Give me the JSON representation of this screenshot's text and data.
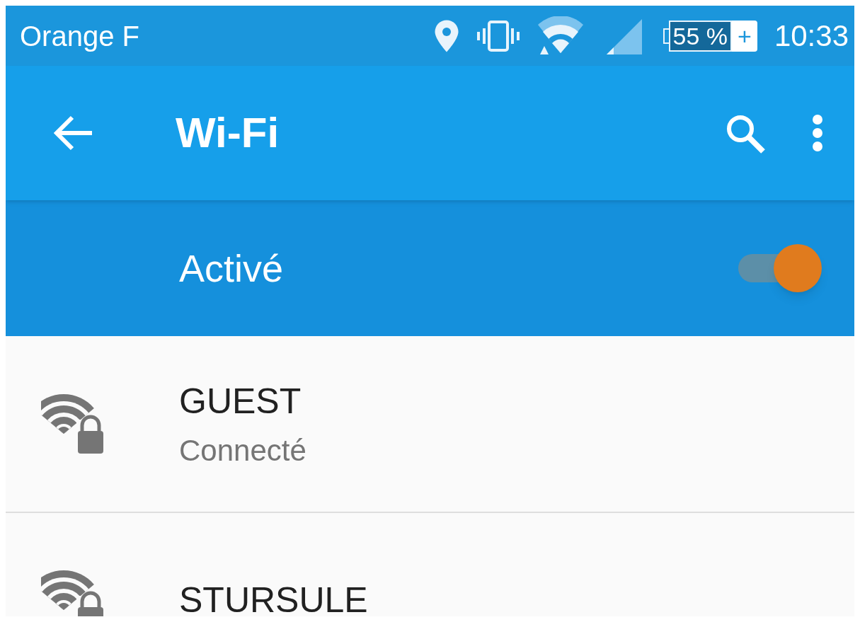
{
  "status_bar": {
    "carrier": "Orange F",
    "battery": "55 %",
    "charging": "+",
    "time": "10:33"
  },
  "toolbar": {
    "title": "Wi-Fi"
  },
  "master_switch": {
    "label": "Activé",
    "on": true
  },
  "networks": [
    {
      "name": "GUEST",
      "status": "Connecté"
    },
    {
      "name": "STURSULE"
    }
  ]
}
